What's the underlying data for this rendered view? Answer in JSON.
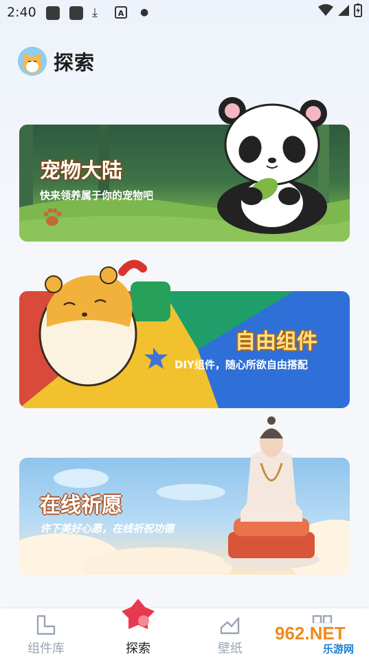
{
  "status_bar": {
    "time": "2:40"
  },
  "header": {
    "title": "探索"
  },
  "cards": [
    {
      "title": "宠物大陆",
      "subtitle": "快来领养属于你的宠物吧"
    },
    {
      "title": "自由组件",
      "subtitle": "DIY组件，随心所欲自由搭配"
    },
    {
      "title": "在线祈愿",
      "subtitle": "许下美好心愿，在线祈祝功德"
    }
  ],
  "tabs": [
    {
      "label": "组件库",
      "icon": "widget-library-icon",
      "active": false
    },
    {
      "label": "探索",
      "icon": "explore-icon",
      "active": true
    },
    {
      "label": "壁纸",
      "icon": "wallpaper-icon",
      "active": false
    },
    {
      "label": "",
      "icon": "grid-icon",
      "active": false
    }
  ],
  "watermark": {
    "text": "962.NET",
    "sub": "乐游网"
  },
  "colors": {
    "accent": "#e8384f",
    "tab_inactive": "#9aa3b5",
    "panda_bg": "#3f6b3d",
    "blue_panel": "#2f6fd8"
  }
}
